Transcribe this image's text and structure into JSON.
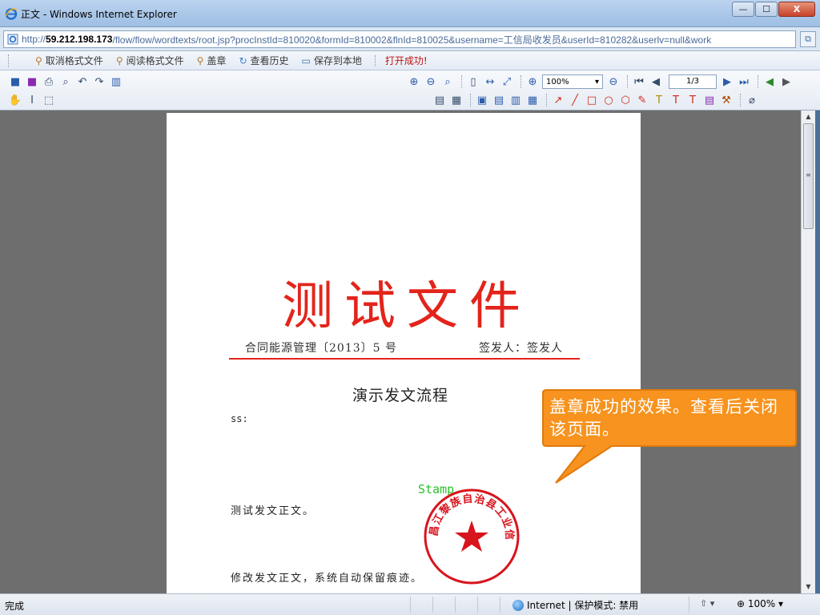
{
  "window": {
    "title": "正文 - Windows Internet Explorer",
    "buttons": {
      "minimize": "—",
      "maximize": "☐",
      "close": "X"
    }
  },
  "address": {
    "prefix": "http://",
    "host": "59.212.198.173",
    "path": "/flow/flow/wordtexts/root.jsp?procInstId=810020&formId=810002&flnId=810025&username=工信局收发员&userId=810282&userlv=null&work"
  },
  "command_bar": {
    "items": [
      {
        "label": "取消格式文件",
        "icon": "person-icon"
      },
      {
        "label": "阅读格式文件",
        "icon": "person-icon"
      },
      {
        "label": "盖章",
        "icon": "person-icon"
      },
      {
        "label": "查看历史",
        "icon": "history-icon"
      },
      {
        "label": "保存到本地",
        "icon": "monitor-icon"
      }
    ],
    "status": "打开成功!"
  },
  "doc_toolbar": {
    "zoom": "100%",
    "page": "1/3"
  },
  "document": {
    "title": "测试文件",
    "doc_number": "合同能源管理〔2013〕5 号",
    "signer": "签发人：签发人",
    "subject": "演示发文流程",
    "addressee": "ss:",
    "paragraph1": "测试发文正文。",
    "paragraph2": "修改发文正文，系统自动保留痕迹。",
    "stamp_label": "Stamp",
    "seal_text": "昌江黎族自治县工业信息化局"
  },
  "callout": {
    "text": "盖章成功的效果。查看后关闭该页面。"
  },
  "status_bar": {
    "left": "完成",
    "zone": "Internet | 保护模式: 禁用",
    "zoom": "100%"
  },
  "colors": {
    "accent_red": "#e3241b",
    "callout_orange": "#f7931e",
    "stamp_green": "#2bc02b"
  }
}
